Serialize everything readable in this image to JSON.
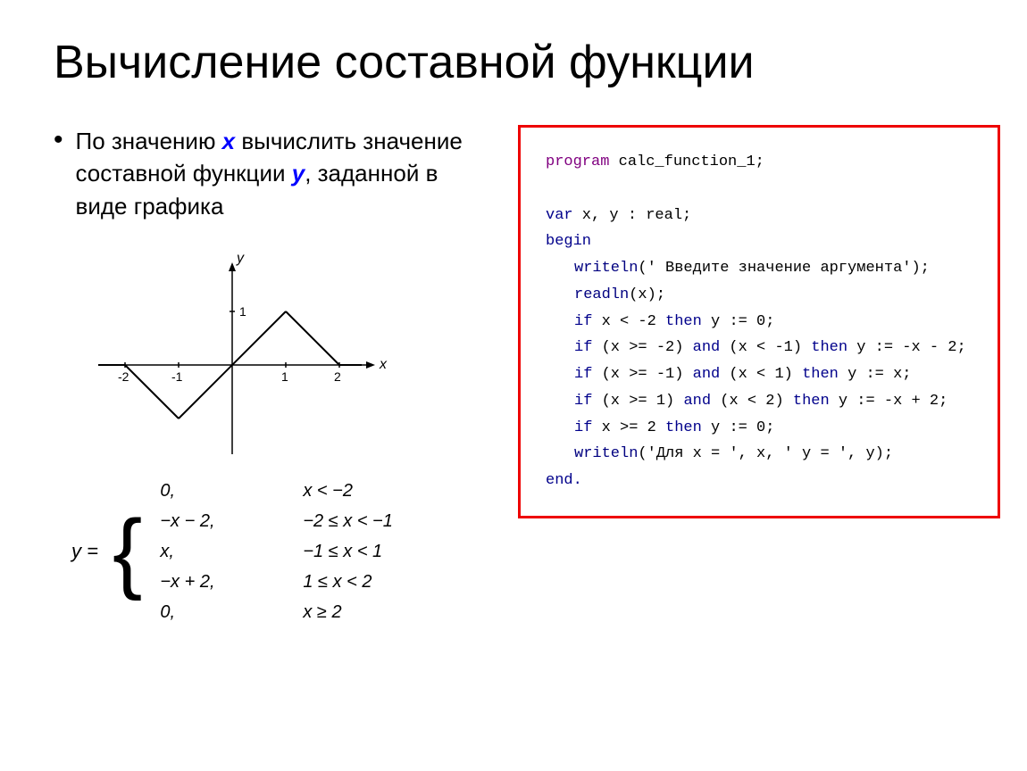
{
  "title": "Вычисление составной функции",
  "bullet": {
    "text_before": "По значению ",
    "x_var": "x",
    "text_middle": " вычислить значение составной функции ",
    "y_var": "у",
    "text_after": ", заданной в виде графика"
  },
  "formula": {
    "y_label": "y =",
    "lines": [
      {
        "expr": "0,",
        "cond": "x < −2"
      },
      {
        "expr": "−x − 2,",
        "cond": "−2 ≤ x < −1"
      },
      {
        "expr": "x,",
        "cond": "−1 ≤ x < 1"
      },
      {
        "expr": "−x + 2,",
        "cond": "1 ≤ x < 2"
      },
      {
        "expr": "0,",
        "cond": "x ≥ 2"
      }
    ]
  },
  "code": {
    "line1": "program calc_function_1;",
    "line2": "",
    "line3_kw": "var",
    "line3_rest": "  x, y : real;",
    "line4_kw": "begin",
    "line5": "writeln(' Введите значение аргумента');",
    "line6": "readln(x);",
    "line7": "if x < -2 then y := 0;",
    "line8_a": "if (x >= -2)",
    "line8_and": "and",
    "line8_b": "(x < -1) then y := -x - 2;",
    "line9_a": "if (x >= -1)",
    "line9_and": "and",
    "line9_b": "(x <  1) then y := x;",
    "line10_a": "if (x >=  1)",
    "line10_and": "and",
    "line10_b": "(x <  2) then y := -x + 2;",
    "line11": "if x >=  2 then y := 0;",
    "line12": "writeln('Для x = ', x, ' y = ', y);",
    "line13_kw": "end."
  }
}
